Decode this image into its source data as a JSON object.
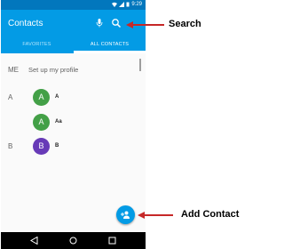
{
  "status_bar": {
    "time": "9:29"
  },
  "app_bar": {
    "title": "Contacts"
  },
  "tabs": {
    "favorites": "FAVORITES",
    "all_contacts": "ALL CONTACTS"
  },
  "profile": {
    "letter": "ME",
    "label": "Set up my profile"
  },
  "contacts": [
    {
      "section": "A",
      "avatar": "A",
      "name": "A"
    },
    {
      "section": "",
      "avatar": "A",
      "name": "Aa"
    },
    {
      "section": "B",
      "avatar": "B",
      "name": "B"
    }
  ],
  "colors": {
    "status_bar": "#0277bd",
    "app_bar": "#039be5",
    "avatar_green": "#43a047",
    "avatar_purple": "#673ab7",
    "annotation": "#c62828"
  },
  "icons": {
    "mic": "mic-icon",
    "search": "search-icon",
    "add_contact": "add-contact-icon",
    "back": "back-icon",
    "home": "home-icon",
    "recent": "recent-apps-icon"
  },
  "annotations": {
    "search": "Search",
    "add_contact": "Add Contact"
  }
}
